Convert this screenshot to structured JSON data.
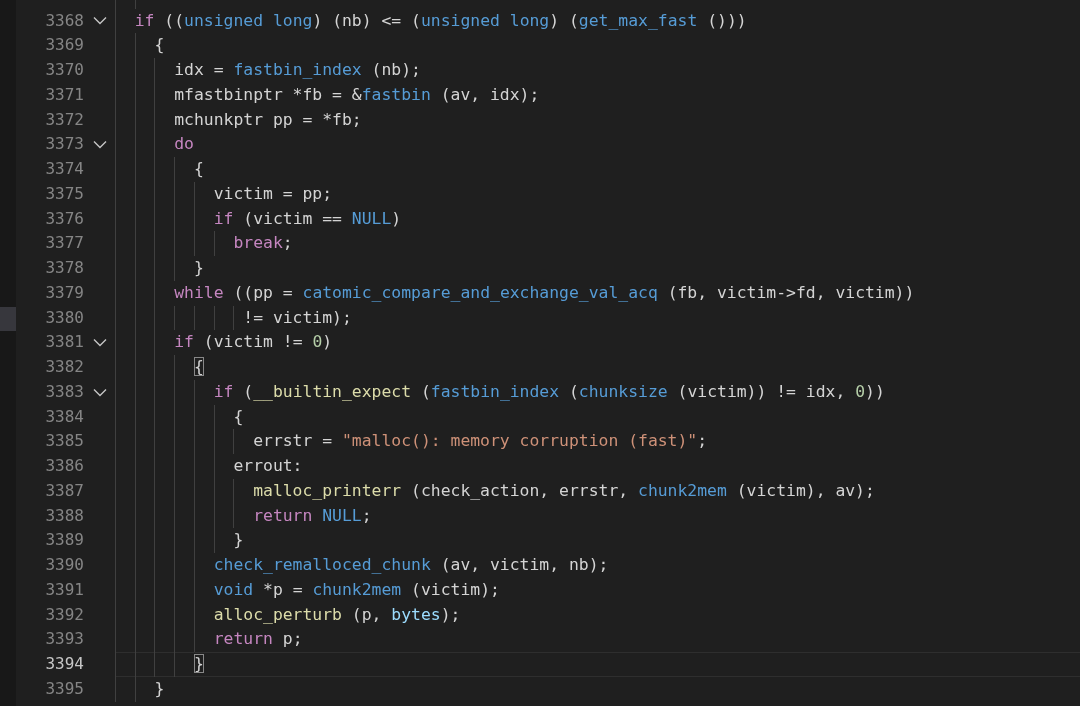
{
  "editor": {
    "lines": [
      {
        "number": "3368",
        "foldable": true,
        "current": false,
        "tokens": [
          {
            "kind": "kw",
            "text": "  if"
          },
          {
            "kind": "plain",
            "text": " (("
          },
          {
            "kind": "type",
            "text": "unsigned long"
          },
          {
            "kind": "plain",
            "text": ") (nb) <= ("
          },
          {
            "kind": "type",
            "text": "unsigned long"
          },
          {
            "kind": "plain",
            "text": ") ("
          },
          {
            "kind": "type",
            "text": "get_max_fast"
          },
          {
            "kind": "plain",
            "text": " ()))"
          }
        ]
      },
      {
        "number": "3369",
        "foldable": false,
        "current": false,
        "tokens": [
          {
            "kind": "plain",
            "text": "    {"
          }
        ]
      },
      {
        "number": "3370",
        "foldable": false,
        "current": false,
        "tokens": [
          {
            "kind": "plain",
            "text": "      idx = "
          },
          {
            "kind": "type",
            "text": "fastbin_index"
          },
          {
            "kind": "plain",
            "text": " (nb);"
          }
        ]
      },
      {
        "number": "3371",
        "foldable": false,
        "current": false,
        "tokens": [
          {
            "kind": "plain",
            "text": "      mfastbinptr *fb = &"
          },
          {
            "kind": "type",
            "text": "fastbin"
          },
          {
            "kind": "plain",
            "text": " (av, idx);"
          }
        ]
      },
      {
        "number": "3372",
        "foldable": false,
        "current": false,
        "tokens": [
          {
            "kind": "plain",
            "text": "      mchunkptr pp = *fb;"
          }
        ]
      },
      {
        "number": "3373",
        "foldable": true,
        "current": false,
        "tokens": [
          {
            "kind": "kw",
            "text": "      do"
          }
        ]
      },
      {
        "number": "3374",
        "foldable": false,
        "current": false,
        "tokens": [
          {
            "kind": "plain",
            "text": "        {"
          }
        ]
      },
      {
        "number": "3375",
        "foldable": false,
        "current": false,
        "tokens": [
          {
            "kind": "plain",
            "text": "          victim = pp;"
          }
        ]
      },
      {
        "number": "3376",
        "foldable": false,
        "current": false,
        "tokens": [
          {
            "kind": "kw",
            "text": "          if"
          },
          {
            "kind": "plain",
            "text": " (victim == "
          },
          {
            "kind": "type",
            "text": "NULL"
          },
          {
            "kind": "plain",
            "text": ")"
          }
        ]
      },
      {
        "number": "3377",
        "foldable": false,
        "current": false,
        "tokens": [
          {
            "kind": "kw",
            "text": "            break"
          },
          {
            "kind": "plain",
            "text": ";"
          }
        ]
      },
      {
        "number": "3378",
        "foldable": false,
        "current": false,
        "tokens": [
          {
            "kind": "plain",
            "text": "        }"
          }
        ]
      },
      {
        "number": "3379",
        "foldable": false,
        "current": false,
        "tokens": [
          {
            "kind": "kw",
            "text": "      while"
          },
          {
            "kind": "plain",
            "text": " ((pp = "
          },
          {
            "kind": "type",
            "text": "catomic_compare_and_exchange_val_acq"
          },
          {
            "kind": "plain",
            "text": " (fb, victim->fd, victim))"
          }
        ]
      },
      {
        "number": "3380",
        "foldable": false,
        "current": false,
        "tokens": [
          {
            "kind": "plain",
            "text": "             != victim);"
          }
        ]
      },
      {
        "number": "3381",
        "foldable": true,
        "current": false,
        "tokens": [
          {
            "kind": "kw",
            "text": "      if"
          },
          {
            "kind": "plain",
            "text": " (victim != "
          },
          {
            "kind": "num",
            "text": "0"
          },
          {
            "kind": "plain",
            "text": ")"
          }
        ]
      },
      {
        "number": "3382",
        "foldable": false,
        "current": false,
        "tokens": [
          {
            "kind": "match",
            "text": "        {"
          }
        ]
      },
      {
        "number": "3383",
        "foldable": true,
        "current": false,
        "tokens": [
          {
            "kind": "kw",
            "text": "          if"
          },
          {
            "kind": "plain",
            "text": " ("
          },
          {
            "kind": "fn",
            "text": "__builtin_expect"
          },
          {
            "kind": "plain",
            "text": " ("
          },
          {
            "kind": "type",
            "text": "fastbin_index"
          },
          {
            "kind": "plain",
            "text": " ("
          },
          {
            "kind": "type",
            "text": "chunksize"
          },
          {
            "kind": "plain",
            "text": " (victim)) != idx, "
          },
          {
            "kind": "num",
            "text": "0"
          },
          {
            "kind": "plain",
            "text": "))"
          }
        ]
      },
      {
        "number": "3384",
        "foldable": false,
        "current": false,
        "tokens": [
          {
            "kind": "plain",
            "text": "            {"
          }
        ]
      },
      {
        "number": "3385",
        "foldable": false,
        "current": false,
        "tokens": [
          {
            "kind": "plain",
            "text": "              errstr = "
          },
          {
            "kind": "str",
            "text": "\"malloc(): memory corruption (fast)\""
          },
          {
            "kind": "plain",
            "text": ";"
          }
        ]
      },
      {
        "number": "3386",
        "foldable": false,
        "current": false,
        "tokens": [
          {
            "kind": "plain",
            "text": "            errout:"
          }
        ]
      },
      {
        "number": "3387",
        "foldable": false,
        "current": false,
        "tokens": [
          {
            "kind": "fn",
            "text": "              malloc_printerr"
          },
          {
            "kind": "plain",
            "text": " (check_action, errstr, "
          },
          {
            "kind": "type",
            "text": "chunk2mem"
          },
          {
            "kind": "plain",
            "text": " (victim), av);"
          }
        ]
      },
      {
        "number": "3388",
        "foldable": false,
        "current": false,
        "tokens": [
          {
            "kind": "kw",
            "text": "              return"
          },
          {
            "kind": "type",
            "text": " NULL"
          },
          {
            "kind": "plain",
            "text": ";"
          }
        ]
      },
      {
        "number": "3389",
        "foldable": false,
        "current": false,
        "tokens": [
          {
            "kind": "plain",
            "text": "            }"
          }
        ]
      },
      {
        "number": "3390",
        "foldable": false,
        "current": false,
        "tokens": [
          {
            "kind": "type",
            "text": "          check_remalloced_chunk"
          },
          {
            "kind": "plain",
            "text": " (av, victim, nb);"
          }
        ]
      },
      {
        "number": "3391",
        "foldable": false,
        "current": false,
        "tokens": [
          {
            "kind": "type",
            "text": "          void"
          },
          {
            "kind": "plain",
            "text": " *p = "
          },
          {
            "kind": "type",
            "text": "chunk2mem"
          },
          {
            "kind": "plain",
            "text": " (victim);"
          }
        ]
      },
      {
        "number": "3392",
        "foldable": false,
        "current": false,
        "tokens": [
          {
            "kind": "fn",
            "text": "          alloc_perturb"
          },
          {
            "kind": "plain",
            "text": " (p, "
          },
          {
            "kind": "var",
            "text": "bytes"
          },
          {
            "kind": "plain",
            "text": ");"
          }
        ]
      },
      {
        "number": "3393",
        "foldable": false,
        "current": false,
        "tokens": [
          {
            "kind": "kw",
            "text": "          return"
          },
          {
            "kind": "plain",
            "text": " p;"
          }
        ]
      },
      {
        "number": "3394",
        "foldable": false,
        "current": true,
        "tokens": [
          {
            "kind": "match",
            "text": "        }"
          }
        ]
      },
      {
        "number": "3395",
        "foldable": false,
        "current": false,
        "tokens": [
          {
            "kind": "plain",
            "text": "    }"
          }
        ]
      }
    ]
  }
}
